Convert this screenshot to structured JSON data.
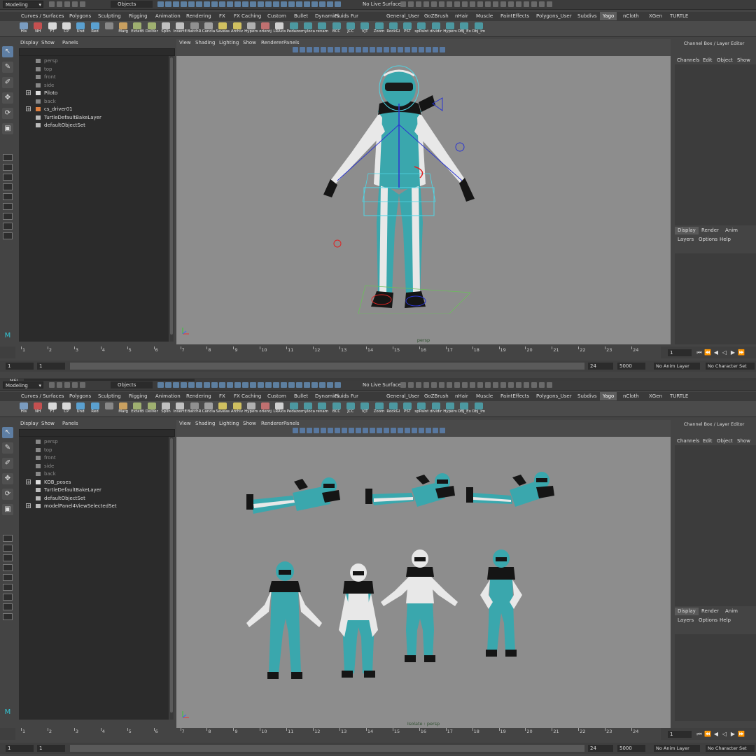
{
  "top": {
    "mode": "Modeling",
    "select_mask": "Objects",
    "live_surface": "No Live Surface",
    "shelf_tabs": [
      "Curves / Surfaces",
      "Polygons",
      "Sculpting",
      "Rigging",
      "Animation",
      "Rendering",
      "FX",
      "FX Caching",
      "Custom",
      "Bullet",
      "Dynamics",
      "Fluids",
      "Fur",
      "General_User",
      "GoZBrush",
      "nHair",
      "Muscle",
      "PaintEffects",
      "Polygons_User",
      "Subdivs",
      "Yago",
      "nCloth",
      "XGen",
      "TURTLE"
    ],
    "active_shelf_tab": "Yago",
    "shelf_buttons": [
      "His",
      "NH",
      "FT",
      "CP",
      "Und",
      "Red",
      "",
      "Marg",
      "ExtatB",
      "DelVer",
      "Splin",
      "InsertE",
      "BatchR",
      "Cancla",
      "Saveas",
      "Archiv",
      "Hypers",
      "orientj",
      "LRAxis",
      "Pedazon",
      "myloca",
      "renam",
      "BCC",
      "JCC",
      "VJT",
      "Zoom",
      "RockGl",
      "PST",
      "spPaint",
      "dividir",
      "Hypers",
      "OBJ_Ex",
      "Obj_im"
    ],
    "outliner_menu": [
      "Display",
      "Show",
      "Panels"
    ],
    "outliner_items": [
      {
        "name": "persp",
        "dim": true,
        "expand": false,
        "icon": "camera"
      },
      {
        "name": "top",
        "dim": true,
        "expand": false,
        "icon": "camera"
      },
      {
        "name": "front",
        "dim": true,
        "expand": false,
        "icon": "camera"
      },
      {
        "name": "side",
        "dim": true,
        "expand": false,
        "icon": "camera"
      },
      {
        "name": "Piloto",
        "dim": false,
        "expand": true,
        "icon": "mesh"
      },
      {
        "name": "back",
        "dim": true,
        "expand": false,
        "icon": "camera"
      },
      {
        "name": "cs_driver01",
        "dim": false,
        "expand": true,
        "icon": "joint"
      },
      {
        "name": "TurtleDefaultBakeLayer",
        "dim": false,
        "expand": false,
        "icon": "set"
      },
      {
        "name": "defaultObjectSet",
        "dim": false,
        "expand": false,
        "icon": "set"
      }
    ],
    "viewport_menu": [
      "View",
      "Shading",
      "Lighting",
      "Show",
      "Renderer",
      "Panels"
    ],
    "camera_label": "persp",
    "channel_box_title": "Channel Box / Layer Editor",
    "channel_menu": [
      "Channels",
      "Edit",
      "Object",
      "Show"
    ],
    "layer_tabs": [
      "Display",
      "Render",
      "Anim"
    ],
    "layer_menu": [
      "Layers",
      "Options",
      "Help"
    ],
    "timeline_ticks": [
      "1",
      "2",
      "3",
      "4",
      "5",
      "6",
      "7",
      "8",
      "9",
      "10",
      "11",
      "12",
      "13",
      "14",
      "15",
      "16",
      "17",
      "18",
      "19",
      "20",
      "21",
      "22",
      "23",
      "24"
    ],
    "current_frame": "1",
    "range_start": "1",
    "range_start_inner": "1",
    "range_end_inner": "24",
    "range_end": "5000",
    "anim_layer": "No Anim Layer",
    "character_set": "No Character Set"
  },
  "bottom": {
    "mel_label": "MEL",
    "mode": "Modeling",
    "select_mask": "Objects",
    "live_surface": "No Live Surface",
    "shelf_tabs": [
      "Curves / Surfaces",
      "Polygons",
      "Sculpting",
      "Rigging",
      "Animation",
      "Rendering",
      "FX",
      "FX Caching",
      "Custom",
      "Bullet",
      "Dynamics",
      "Fluids",
      "Fur",
      "General_User",
      "GoZBrush",
      "nHair",
      "Muscle",
      "PaintEffects",
      "Polygons_User",
      "Subdivs",
      "Yago",
      "nCloth",
      "XGen",
      "TURTLE"
    ],
    "active_shelf_tab": "Yago",
    "shelf_buttons": [
      "His",
      "NH",
      "FT",
      "CP",
      "Und",
      "Red",
      "",
      "Marg",
      "ExtatB",
      "DelVer",
      "Splin",
      "InsertE",
      "BatchR",
      "Cancla",
      "Saveas",
      "Archiv",
      "Hypers",
      "orientj",
      "LRAxis",
      "Pedazon",
      "myloca",
      "renam",
      "BCC",
      "JCC",
      "VJT",
      "Zoom",
      "RockGl",
      "PST",
      "spPaint",
      "dividir",
      "Hypers",
      "OBJ_Ex",
      "Obj_im"
    ],
    "outliner_menu": [
      "Display",
      "Show",
      "Panels"
    ],
    "outliner_items": [
      {
        "name": "persp",
        "dim": true,
        "expand": false,
        "icon": "camera"
      },
      {
        "name": "top",
        "dim": true,
        "expand": false,
        "icon": "camera"
      },
      {
        "name": "front",
        "dim": true,
        "expand": false,
        "icon": "camera"
      },
      {
        "name": "side",
        "dim": true,
        "expand": false,
        "icon": "camera"
      },
      {
        "name": "back",
        "dim": true,
        "expand": false,
        "icon": "camera"
      },
      {
        "name": "KOB_poses",
        "dim": false,
        "expand": true,
        "icon": "mesh"
      },
      {
        "name": "TurtleDefaultBakeLayer",
        "dim": false,
        "expand": false,
        "icon": "set"
      },
      {
        "name": "defaultObjectSet",
        "dim": false,
        "expand": false,
        "icon": "set"
      },
      {
        "name": "modelPanel4ViewSelectedSet",
        "dim": false,
        "expand": true,
        "icon": "set"
      }
    ],
    "viewport_menu": [
      "View",
      "Shading",
      "Lighting",
      "Show",
      "Renderer",
      "Panels"
    ],
    "camera_label": "Isolate : persp",
    "channel_box_title": "Channel Box / Layer Editor",
    "channel_menu": [
      "Channels",
      "Edit",
      "Object",
      "Show"
    ],
    "layer_tabs": [
      "Display",
      "Render",
      "Anim"
    ],
    "layer_menu": [
      "Layers",
      "Options",
      "Help"
    ],
    "timeline_ticks": [
      "1",
      "2",
      "3",
      "4",
      "5",
      "6",
      "7",
      "8",
      "9",
      "10",
      "11",
      "12",
      "13",
      "14",
      "15",
      "16",
      "17",
      "18",
      "19",
      "20",
      "21",
      "22",
      "23",
      "24"
    ],
    "current_frame": "1",
    "range_start": "1",
    "range_start_inner": "1",
    "range_end_inner": "24",
    "range_end": "5000",
    "anim_layer": "No Anim Layer",
    "character_set": "No Character Set"
  },
  "colors": {
    "suit_teal": "#3aa7ad",
    "suit_white": "#e8e8e8",
    "suit_black": "#151515",
    "viewport_bg": "#8d8d8d",
    "accent_blue": "#5e7ea3"
  }
}
